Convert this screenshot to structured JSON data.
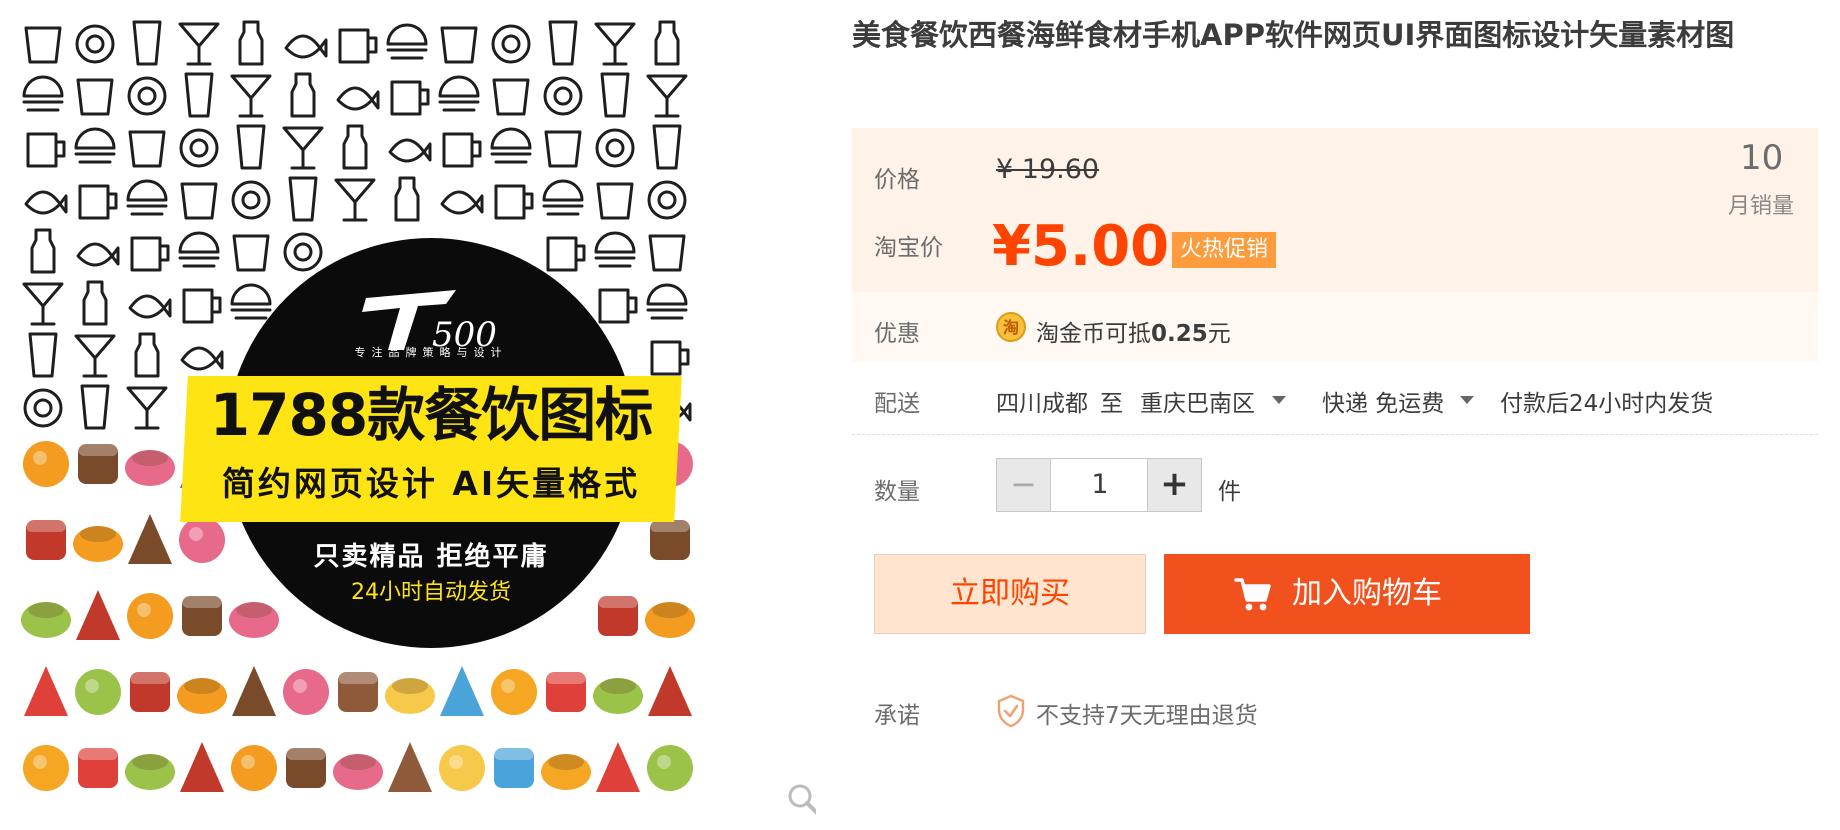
{
  "product": {
    "title": "美食餐饮西餐海鲜食材手机APP软件网页UI界面图标设计矢量素材图"
  },
  "image": {
    "logo_text": "T500",
    "tagline": "专注品牌策略与设计",
    "headline": "1788款餐饮图标",
    "subheadline": "简约网页设计 AI矢量格式",
    "slogan": "只卖精品 拒绝平庸",
    "shipping_note": "24小时自动发货"
  },
  "price": {
    "label": "价格",
    "original": "¥ 19.60",
    "promo_label": "淘宝价",
    "promo_value": "¥5.00",
    "promo_tag": "火热促销",
    "monthly_sales": "10",
    "monthly_sales_label": "月销量"
  },
  "coupon": {
    "label": "优惠",
    "icon_char": "淘",
    "text_prefix": "淘金币可抵",
    "amount": "0.25",
    "unit": "元"
  },
  "shipping": {
    "label": "配送",
    "from": "四川成都",
    "to_word": "至",
    "destination": "重庆巴南区",
    "method": "快递 免运费",
    "dispatch": "付款后24小时内发货"
  },
  "quantity": {
    "label": "数量",
    "minus": "−",
    "value": "1",
    "plus": "+",
    "unit": "件"
  },
  "actions": {
    "buy_now": "立即购买",
    "add_to_cart": "加入购物车"
  },
  "promise": {
    "label": "承诺",
    "text": "不支持7天无理由退货"
  },
  "colors": {
    "accent": "#ff4400",
    "cart_button": "#f0511d",
    "price_panel": "#fff2e8",
    "promo_tag": "#fc9c3c",
    "banner_yellow": "#ffe413"
  },
  "icons": [
    "search-zoom-icon",
    "gold-coin-icon",
    "shopping-cart-icon",
    "shield-check-icon",
    "caret-down-icon"
  ]
}
